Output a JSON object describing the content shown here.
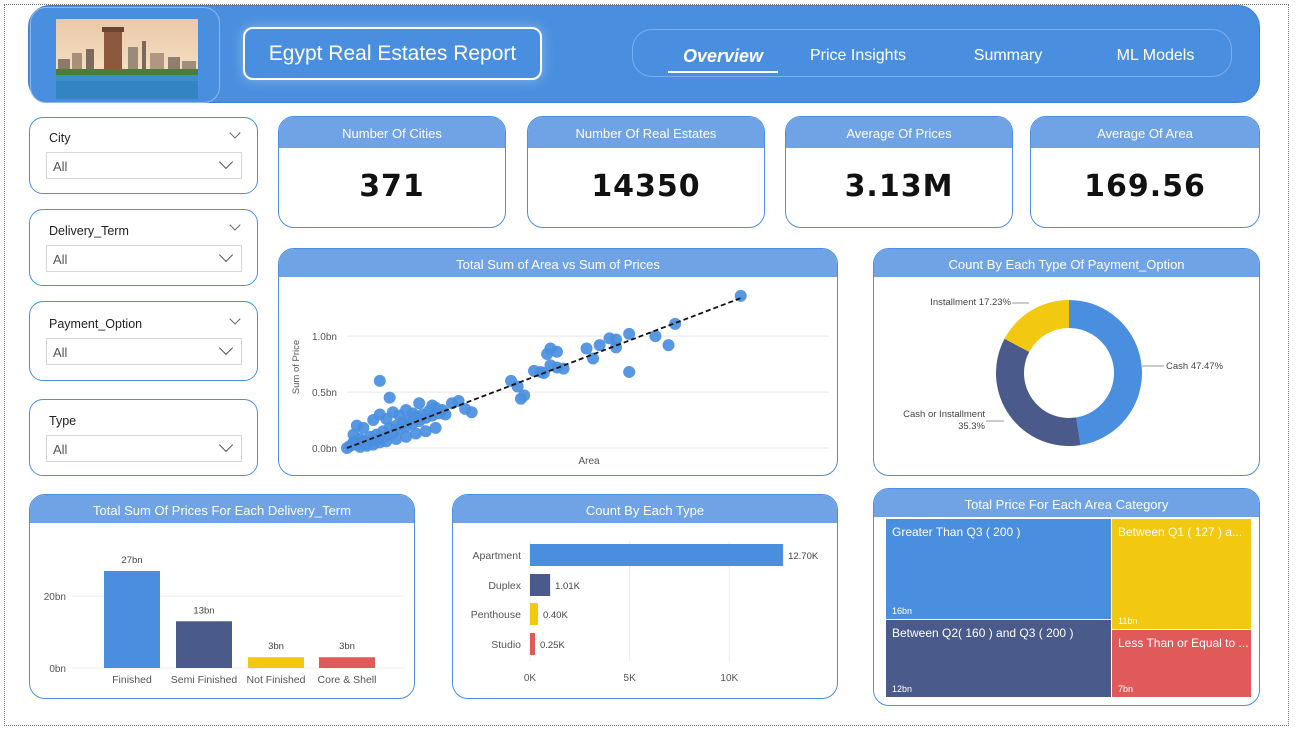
{
  "header": {
    "title": "Egypt Real Estates Report",
    "nav": [
      {
        "label": "Overview",
        "active": true
      },
      {
        "label": "Price Insights",
        "active": false
      },
      {
        "label": "Summary",
        "active": false
      },
      {
        "label": "ML Models",
        "active": false
      }
    ]
  },
  "filters": [
    {
      "label": "City",
      "value": "All"
    },
    {
      "label": "Delivery_Term",
      "value": "All"
    },
    {
      "label": "Payment_Option",
      "value": "All"
    },
    {
      "label": "Type",
      "value": "All"
    }
  ],
  "kpis": [
    {
      "label": "Number Of Cities",
      "value": "371"
    },
    {
      "label": "Number Of Real Estates",
      "value": "14350"
    },
    {
      "label": "Average Of Prices",
      "value": "3.13M"
    },
    {
      "label": "Average Of Area",
      "value": "169.56"
    }
  ],
  "colors": {
    "primary": "#4a8fdf",
    "header_bar": "#6fa3e5",
    "navy": "#4a5a8a",
    "yellow": "#f2c811",
    "red": "#e05a5a"
  },
  "chart_data": [
    {
      "type": "scatter",
      "title": "Total Sum of Area vs Sum of Prices",
      "xlabel": "Area",
      "ylabel": "Sum of Price",
      "y_ticks": [
        "0.0bn",
        "0.5bn",
        "1.0bn"
      ],
      "ylim": [
        0,
        1.35
      ],
      "trendline": true,
      "points": [
        [
          0.0,
          0.0
        ],
        [
          0.01,
          0.02
        ],
        [
          0.02,
          0.05
        ],
        [
          0.03,
          0.03
        ],
        [
          0.04,
          0.08
        ],
        [
          0.05,
          0.06
        ],
        [
          0.06,
          0.04
        ],
        [
          0.07,
          0.1
        ],
        [
          0.08,
          0.07
        ],
        [
          0.09,
          0.12
        ],
        [
          0.1,
          0.09
        ],
        [
          0.11,
          0.15
        ],
        [
          0.12,
          0.11
        ],
        [
          0.13,
          0.18
        ],
        [
          0.14,
          0.13
        ],
        [
          0.15,
          0.2
        ],
        [
          0.16,
          0.17
        ],
        [
          0.17,
          0.23
        ],
        [
          0.18,
          0.19
        ],
        [
          0.19,
          0.25
        ],
        [
          0.2,
          0.22
        ],
        [
          0.21,
          0.28
        ],
        [
          0.22,
          0.24
        ],
        [
          0.23,
          0.3
        ],
        [
          0.24,
          0.27
        ],
        [
          0.25,
          0.33
        ],
        [
          0.26,
          0.29
        ],
        [
          0.27,
          0.36
        ],
        [
          0.28,
          0.31
        ],
        [
          0.29,
          0.34
        ],
        [
          0.02,
          0.12
        ],
        [
          0.03,
          0.2
        ],
        [
          0.05,
          0.18
        ],
        [
          0.08,
          0.25
        ],
        [
          0.1,
          0.3
        ],
        [
          0.12,
          0.26
        ],
        [
          0.14,
          0.32
        ],
        [
          0.16,
          0.29
        ],
        [
          0.18,
          0.34
        ],
        [
          0.2,
          0.31
        ],
        [
          0.04,
          0.01
        ],
        [
          0.06,
          0.02
        ],
        [
          0.08,
          0.03
        ],
        [
          0.1,
          0.05
        ],
        [
          0.12,
          0.06
        ],
        [
          0.15,
          0.08
        ],
        [
          0.18,
          0.1
        ],
        [
          0.21,
          0.13
        ],
        [
          0.24,
          0.15
        ],
        [
          0.27,
          0.18
        ],
        [
          0.1,
          0.6
        ],
        [
          0.13,
          0.45
        ],
        [
          0.22,
          0.4
        ],
        [
          0.26,
          0.38
        ],
        [
          0.3,
          0.3
        ],
        [
          0.32,
          0.4
        ],
        [
          0.34,
          0.42
        ],
        [
          0.36,
          0.35
        ],
        [
          0.38,
          0.32
        ],
        [
          0.5,
          0.6
        ],
        [
          0.52,
          0.55
        ],
        [
          0.53,
          0.44
        ],
        [
          0.54,
          0.47
        ],
        [
          0.57,
          0.69
        ],
        [
          0.59,
          0.68
        ],
        [
          0.6,
          0.67
        ],
        [
          0.62,
          0.74
        ],
        [
          0.64,
          0.72
        ],
        [
          0.66,
          0.71
        ],
        [
          0.61,
          0.84
        ],
        [
          0.62,
          0.89
        ],
        [
          0.64,
          0.86
        ],
        [
          0.73,
          0.89
        ],
        [
          0.75,
          0.8
        ],
        [
          0.77,
          0.92
        ],
        [
          0.8,
          0.98
        ],
        [
          0.82,
          0.97
        ],
        [
          0.86,
          1.02
        ],
        [
          0.82,
          0.9
        ],
        [
          0.86,
          0.68
        ],
        [
          0.94,
          1.0
        ],
        [
          1.0,
          1.11
        ],
        [
          0.98,
          0.92
        ],
        [
          1.2,
          1.36
        ]
      ]
    },
    {
      "type": "pie",
      "title": "Count By Each Type Of Payment_Option",
      "slices": [
        {
          "label": "Cash 47.47%",
          "value": 47.47,
          "color": "#4a8fdf"
        },
        {
          "label": "Cash or Installment",
          "label2": "35.3%",
          "value": 35.3,
          "color": "#4a5a8a"
        },
        {
          "label": "Installment 17.23%",
          "value": 17.23,
          "color": "#f2c811"
        }
      ]
    },
    {
      "type": "bar",
      "title": "Total Sum Of Prices For Each  Delivery_Term",
      "categories": [
        "Finished",
        "Semi Finished",
        "Not Finished",
        "Core & Shell"
      ],
      "values": [
        27,
        13,
        3,
        3
      ],
      "labels": [
        "27bn",
        "13bn",
        "3bn",
        "3bn"
      ],
      "colors": [
        "#4a8fdf",
        "#4a5a8a",
        "#f2c811",
        "#e05a5a"
      ],
      "y_ticks": [
        "0bn",
        "20bn"
      ],
      "ylim": [
        0,
        32
      ]
    },
    {
      "type": "bar",
      "orientation": "horizontal",
      "title": "Count By Each Type",
      "categories": [
        "Apartment",
        "Duplex",
        "Penthouse",
        "Studio"
      ],
      "values": [
        12.7,
        1.01,
        0.4,
        0.25
      ],
      "labels": [
        "12.70K",
        "1.01K",
        "0.40K",
        "0.25K"
      ],
      "colors": [
        "#4a8fdf",
        "#4a5a8a",
        "#f2c811",
        "#e05a5a"
      ],
      "x_ticks": [
        "0K",
        "5K",
        "10K"
      ],
      "xlim": [
        0,
        14.2
      ]
    },
    {
      "type": "treemap",
      "title": "Total Price For Each Area Category",
      "cells": [
        {
          "label": "Greater Than Q3 ( 200 )",
          "value": "16bn",
          "color": "#4a8fdf"
        },
        {
          "label": "Between Q1 ( 127 ) a...",
          "value": "11bn",
          "color": "#f2c811"
        },
        {
          "label": "Between Q2( 160 ) and Q3 ( 200 )",
          "value": "12bn",
          "color": "#4a5a8a"
        },
        {
          "label": "Less Than or Equal to ...",
          "value": "7bn",
          "color": "#e05a5a"
        }
      ]
    }
  ]
}
